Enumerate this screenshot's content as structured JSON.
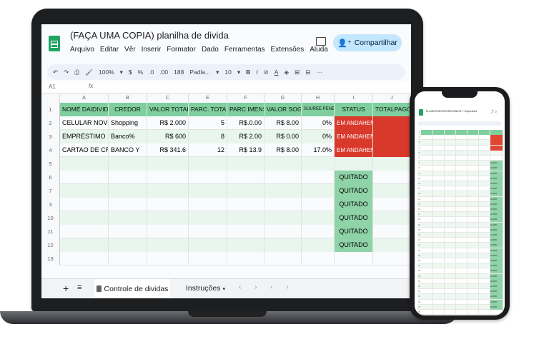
{
  "spreadsheet": {
    "title": "(FAÇA UMA COPIA)  planilha de divida",
    "menu": [
      "Arquivo",
      "Editar",
      "Vêr",
      "Inserir",
      "Formator",
      "Dado",
      "Ferramentas",
      "Extensões",
      "Aluda"
    ],
    "share_label": "Compartilhar",
    "toolbar": {
      "zoom": "100%",
      "currency": "$",
      "percent": "%",
      "decimals_less": ".0",
      "decimals_more": ".00",
      "number_format": "188",
      "font": "Padla...",
      "font_size": "10",
      "bold": "B",
      "italic": "I",
      "more": "···"
    },
    "formula_bar": {
      "cell_ref": "A1",
      "fx": "fx"
    },
    "column_letters": [
      "A",
      "B",
      "C",
      "E",
      "F",
      "G",
      "H",
      "I",
      "J"
    ],
    "header_row": {
      "row_number": "1",
      "cells": [
        "NOMÉ DAIDIVIDA",
        "CREDOR",
        "VALOR TOTAL",
        "PARC. TOTAIS",
        "PARC IMENSA",
        "VALOR SOG",
        "SUUREE PENECO",
        "STATUS",
        "TOTALPAGO"
      ]
    },
    "rows": [
      {
        "n": "2",
        "cells": [
          "CELULAR NOVO",
          "Shopping",
          "R$ 2.000",
          "5",
          "R$.0.00",
          "R$ 8.00",
          "0%",
          "EM ANDAHENTO",
          ""
        ]
      },
      {
        "n": "3",
        "cells": [
          "EMPRÉSTIMO",
          "Banco%",
          "R$ 600",
          "8",
          "R$ 2.00",
          "R$ 0.00",
          "0%",
          "EM ANDAHENTO",
          ""
        ]
      },
      {
        "n": "4",
        "cells": [
          "CARTAO DE CRE",
          "BANCO Y",
          "R$ 341.6",
          "12",
          "R$ 13.9",
          "R$ 8.00",
          "17.0%",
          "EM ANDAHENTO",
          ""
        ]
      },
      {
        "n": "5",
        "cells": [
          "",
          "",
          "",
          "",
          "",
          "",
          "",
          "",
          ""
        ]
      },
      {
        "n": "6",
        "cells": [
          "",
          "",
          "",
          "",
          "",
          "",
          "",
          "QUITADO",
          ""
        ]
      },
      {
        "n": "7",
        "cells": [
          "",
          "",
          "",
          "",
          "",
          "",
          "",
          "QUITADO",
          ""
        ]
      },
      {
        "n": "3",
        "cells": [
          "",
          "",
          "",
          "",
          "",
          "",
          "",
          "QUITADO",
          ""
        ]
      },
      {
        "n": "10",
        "cells": [
          "",
          "",
          "",
          "",
          "",
          "",
          "",
          "QUITADO",
          ""
        ]
      },
      {
        "n": "11",
        "cells": [
          "",
          "",
          "",
          "",
          "",
          "",
          "",
          "QUITADO",
          ""
        ]
      },
      {
        "n": "12",
        "cells": [
          "",
          "",
          "",
          "",
          "",
          "",
          "",
          "QUITADO",
          ""
        ]
      },
      {
        "n": "13",
        "cells": [
          "",
          "",
          "",
          "",
          "",
          "",
          "",
          "",
          ""
        ]
      }
    ],
    "sheet_tabs": {
      "active": "Controle de dividas",
      "second": "Instruções"
    }
  },
  "phone": {
    "title": "ELANERORRIORGRATIANIOS Y",
    "title_suffix": "Wqesnethd",
    "rows": [
      "1",
      "2",
      "3",
      "4",
      "5",
      "6",
      "7",
      "8",
      "9",
      "10",
      "11",
      "12",
      "13",
      "14",
      "15",
      "16",
      "17",
      "18",
      "19",
      "20",
      "21",
      "22",
      "23",
      "24",
      "25",
      "26",
      "27",
      "28",
      "29",
      "30",
      "31",
      "32",
      "33",
      "34",
      "35",
      "36",
      "37",
      "38",
      "39",
      "40"
    ],
    "status_cells": [
      "EU3305",
      "EU3305",
      "EU3105",
      "EU3525",
      "EU3305",
      "EU3905",
      "EU3305",
      "EU3305",
      "EU3305",
      "EU3305",
      "EU3305",
      "EU3305",
      "EU3305",
      "EU3305",
      "EU3305",
      "EU3305",
      "EU3305",
      "EU3305",
      "EU3305",
      "EU3305",
      "EU3305",
      "EU3305",
      "EU3305",
      "EU3305",
      "EU3305",
      "EU3305",
      "EU3305",
      "EU3305",
      "EU3305"
    ]
  },
  "colors": {
    "header_green": "#7fcf9e",
    "status_red": "#d9392b",
    "status_green": "#8fd3a8",
    "share_blue": "#c2e7ff"
  }
}
